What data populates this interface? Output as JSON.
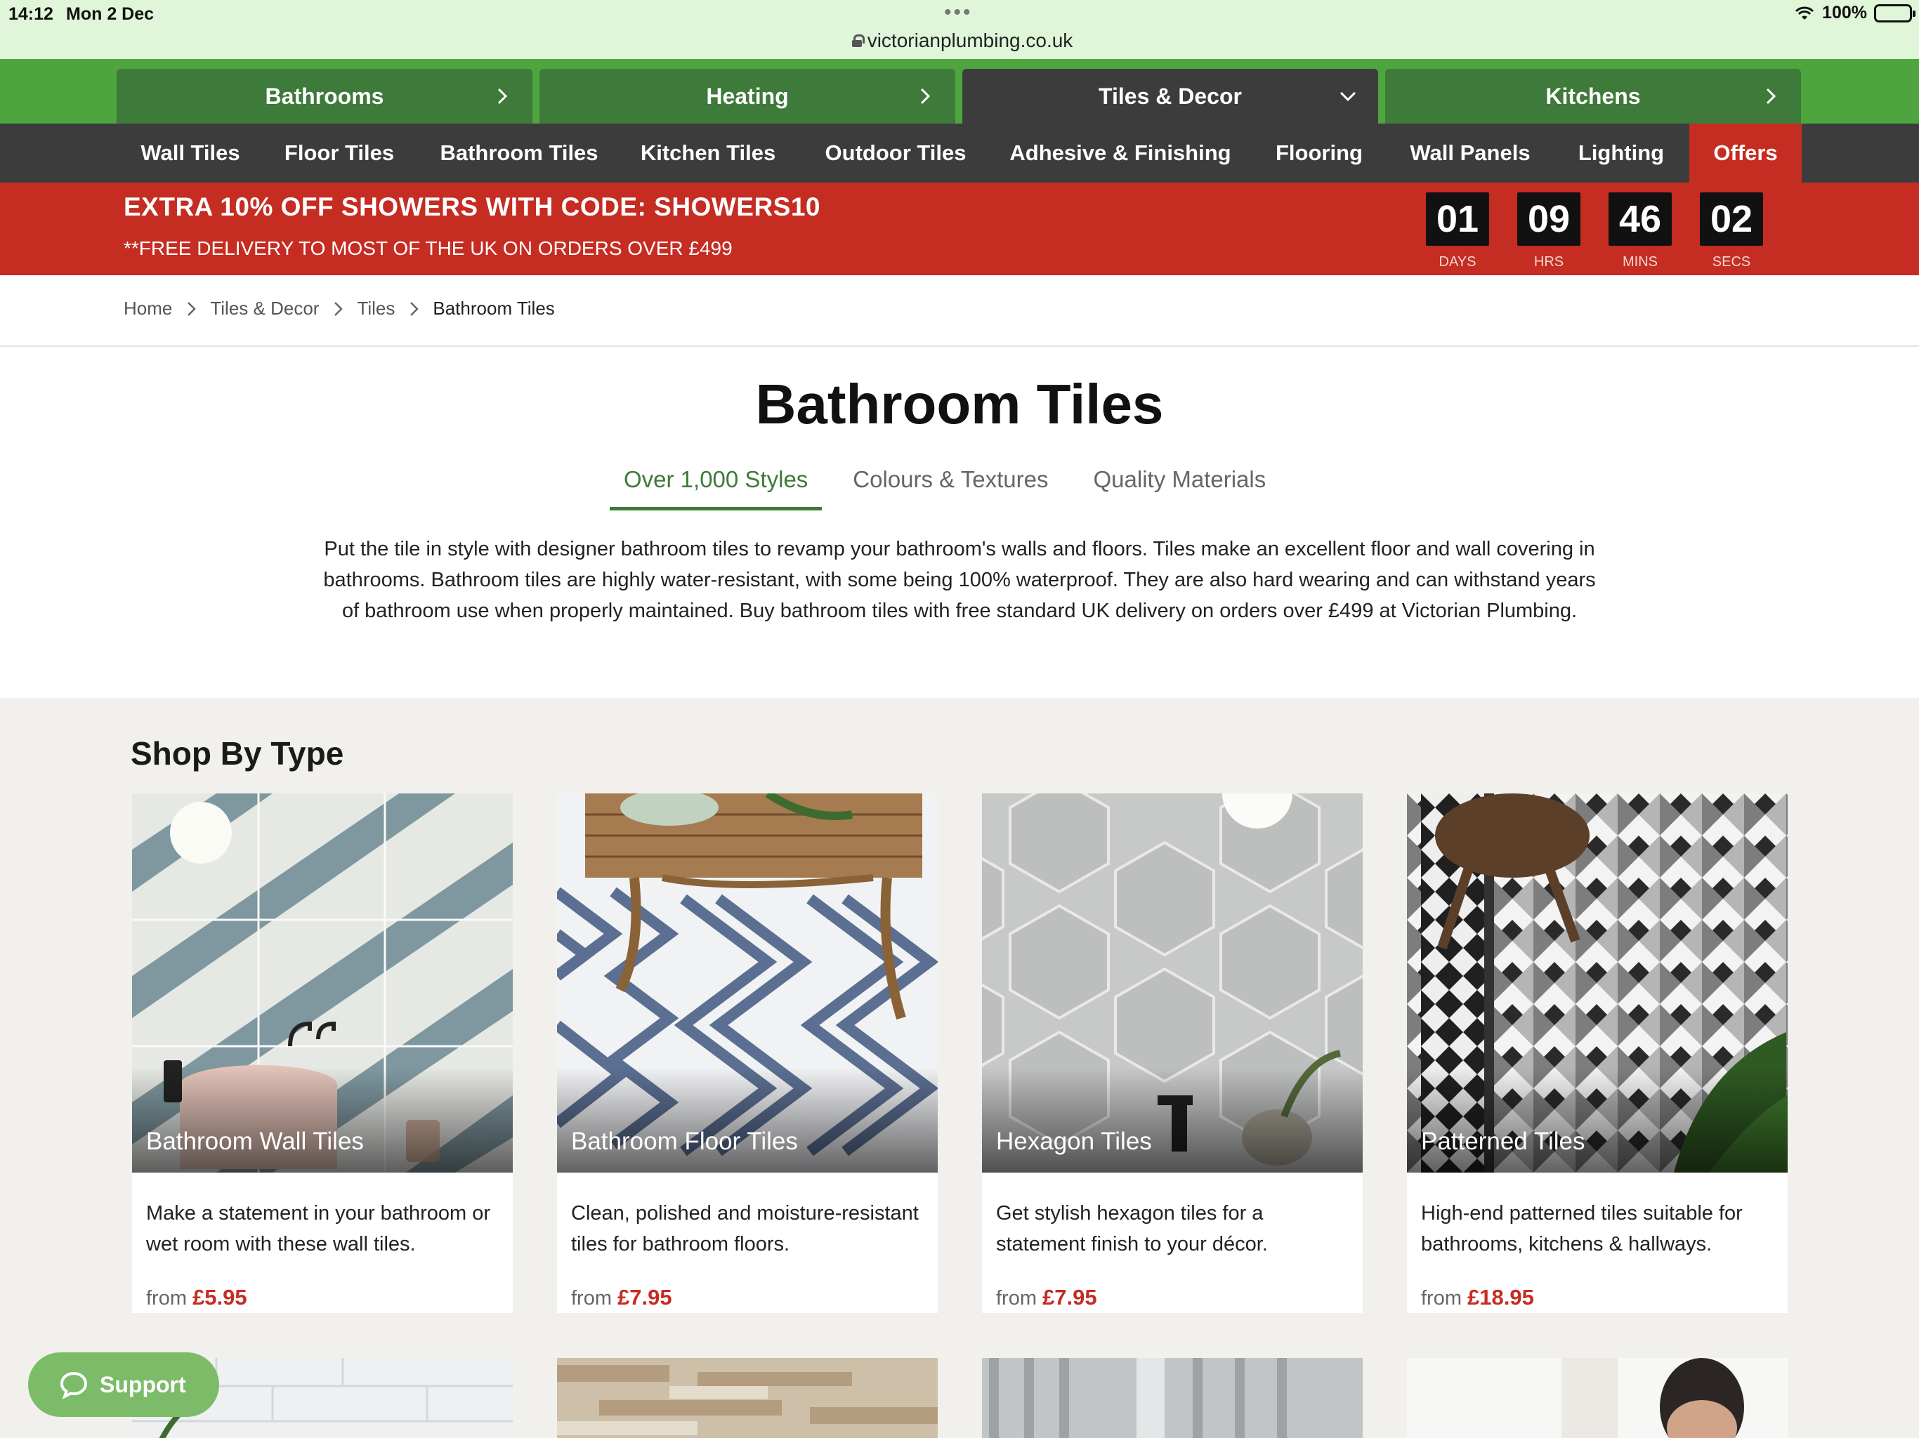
{
  "status_bar": {
    "time": "14:12",
    "date": "Mon 2 Dec",
    "battery": "100%"
  },
  "browser": {
    "url": "victorianplumbing.co.uk"
  },
  "main_nav": {
    "tabs": [
      {
        "label": "Bathrooms",
        "icon": "chevron-right-icon"
      },
      {
        "label": "Heating",
        "icon": "chevron-right-icon"
      },
      {
        "label": "Tiles & Decor",
        "icon": "chevron-down-icon",
        "active": true
      },
      {
        "label": "Kitchens",
        "icon": "chevron-right-icon"
      }
    ]
  },
  "sub_nav": {
    "items": [
      {
        "label": "Wall Tiles"
      },
      {
        "label": "Floor Tiles"
      },
      {
        "label": "Bathroom Tiles"
      },
      {
        "label": "Kitchen Tiles"
      },
      {
        "label": "Outdoor Tiles"
      },
      {
        "label": "Adhesive & Finishing"
      },
      {
        "label": "Flooring"
      },
      {
        "label": "Wall Panels"
      },
      {
        "label": "Lighting"
      },
      {
        "label": "Offers",
        "highlight": true
      }
    ]
  },
  "promo": {
    "headline": "EXTRA 10% OFF SHOWERS WITH CODE: SHOWERS10",
    "subline": "**FREE DELIVERY TO MOST OF THE UK ON ORDERS OVER £499",
    "countdown": [
      {
        "value": "01",
        "label": "DAYS"
      },
      {
        "value": "09",
        "label": "HRS"
      },
      {
        "value": "46",
        "label": "MINS"
      },
      {
        "value": "02",
        "label": "SECS"
      }
    ]
  },
  "breadcrumb": {
    "items": [
      "Home",
      "Tiles & Decor",
      "Tiles",
      "Bathroom Tiles"
    ]
  },
  "page": {
    "title": "Bathroom Tiles",
    "info_tabs": [
      {
        "label": "Over 1,000 Styles",
        "active": true
      },
      {
        "label": "Colours & Textures"
      },
      {
        "label": "Quality Materials"
      }
    ],
    "intro": "Put the tile in style with designer bathroom tiles to revamp your bathroom's walls and floors. Tiles make an excellent floor and wall covering in bathrooms. Bathroom tiles are highly water-resistant, with some being 100% waterproof. They are also hard wearing and can withstand years of bathroom use when properly maintained. Buy bathroom tiles with free standard UK delivery on orders over £499 at Victorian Plumbing."
  },
  "shop_by_type": {
    "title": "Shop By Type",
    "cards": [
      {
        "title": "Bathroom Wall Tiles",
        "description": "Make a statement in your bathroom or wet room with these wall tiles.",
        "from": "from",
        "price": "£5.95"
      },
      {
        "title": "Bathroom Floor Tiles",
        "description": "Clean, polished and moisture-resistant tiles for bathroom floors.",
        "from": "from",
        "price": "£7.95"
      },
      {
        "title": "Hexagon Tiles",
        "description": "Get stylish hexagon tiles for a statement finish to your décor.",
        "from": "from",
        "price": "£7.95"
      },
      {
        "title": "Patterned Tiles",
        "description": "High-end patterned tiles suitable for bathrooms, kitchens & hallways.",
        "from": "from",
        "price": "£18.95"
      }
    ]
  },
  "support": {
    "label": "Support"
  },
  "colors": {
    "nav_green": "#4fa53d",
    "tab_green": "#3e7a39",
    "dark_nav": "#3c3c3c",
    "promo_red": "#c52c22",
    "section_bg": "#f1f0ec"
  }
}
